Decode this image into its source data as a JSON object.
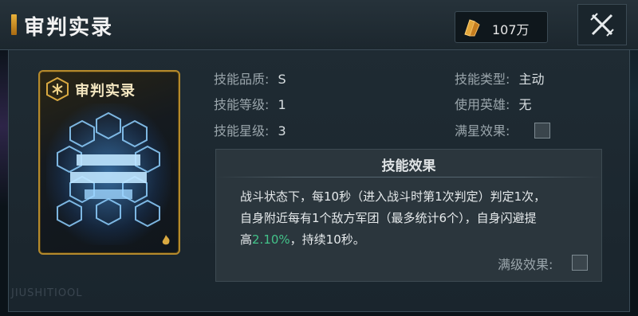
{
  "header": {
    "title": "审判实录",
    "currency_value": "107万"
  },
  "card": {
    "title": "审判实录"
  },
  "stats": {
    "quality_label": "技能品质:",
    "quality_value": "S",
    "level_label": "技能等级:",
    "level_value": "1",
    "star_label": "技能星级:",
    "star_value": "3",
    "type_label": "技能类型:",
    "type_value": "主动",
    "hero_label": "使用英雄:",
    "hero_value": "无",
    "fullstar_label": "满星效果:"
  },
  "effect": {
    "title": "技能效果",
    "line1": "战斗状态下，每10秒（进入战斗时第1次判定）判定1次，",
    "line2": "自身附近每有1个敌方军团（最多统计6个），自身闪避提",
    "line3_pre": "高",
    "line3_percent": "2.10%",
    "line3_post": "，持续10秒。",
    "maxlevel_label": "满级效果:"
  },
  "watermark": "JIUSHITIOOL",
  "colors": {
    "accent_gold": "#e9b13a",
    "effect_green": "#43c38a"
  }
}
